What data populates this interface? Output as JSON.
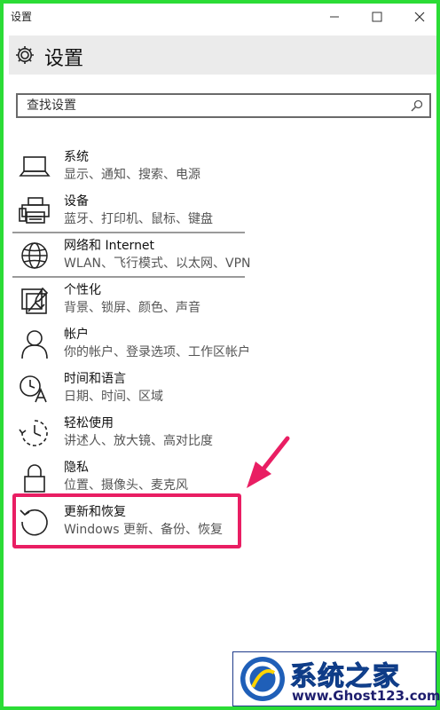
{
  "window": {
    "title": "设置"
  },
  "header": {
    "page_title": "设置"
  },
  "search": {
    "placeholder": "查找设置"
  },
  "categories": [
    {
      "name": "系统",
      "desc": "显示、通知、搜索、电源",
      "icon": "laptop-icon"
    },
    {
      "name": "设备",
      "desc": "蓝牙、打印机、鼠标、键盘",
      "icon": "printer-icon"
    },
    {
      "name": "网络和 Internet",
      "desc": "WLAN、飞行模式、以太网、VPN",
      "icon": "globe-icon"
    },
    {
      "name": "个性化",
      "desc": "背景、锁屏、颜色、声音",
      "icon": "personalization-icon"
    },
    {
      "name": "帐户",
      "desc": "你的帐户、登录选项、工作区帐户",
      "icon": "person-icon"
    },
    {
      "name": "时间和语言",
      "desc": "日期、时间、区域",
      "icon": "time-language-icon"
    },
    {
      "name": "轻松使用",
      "desc": "讲述人、放大镜、高对比度",
      "icon": "ease-of-access-icon"
    },
    {
      "name": "隐私",
      "desc": "位置、摄像头、麦克风",
      "icon": "lock-icon"
    },
    {
      "name": "更新和恢复",
      "desc": "Windows 更新、备份、恢复",
      "icon": "update-icon"
    }
  ],
  "annotation": {
    "highlight_color": "#e91e63"
  },
  "watermark": {
    "brand": "系统之家",
    "site": "www.Ghost123.com"
  },
  "colors": {
    "frame": "#2bdc36",
    "header_bg": "#ebebeb",
    "watermark_blue": "#1f5fb8"
  }
}
